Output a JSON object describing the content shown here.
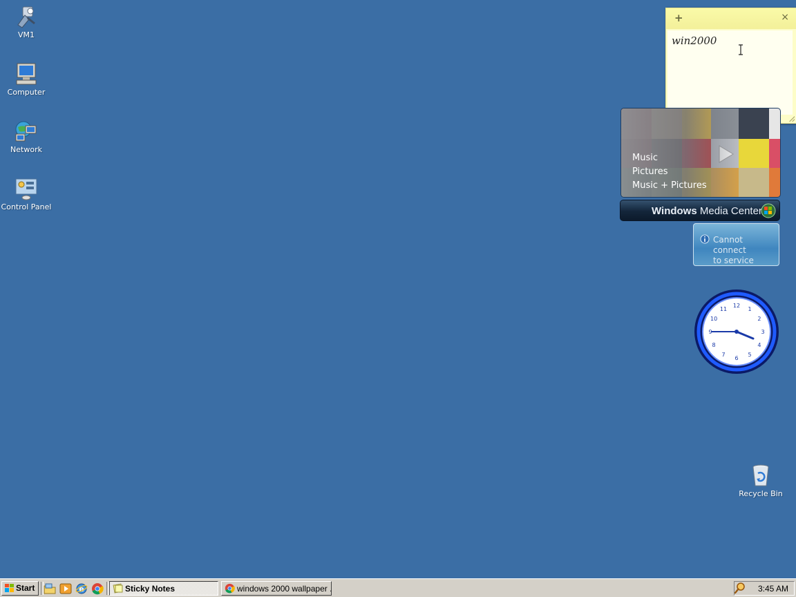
{
  "desktop": {
    "background_color": "#3b6ea5",
    "icons": [
      {
        "label": "VM1",
        "icon": "vm-icon"
      },
      {
        "label": "Computer",
        "icon": "computer-icon"
      },
      {
        "label": "Network",
        "icon": "network-icon"
      },
      {
        "label": "Control Panel",
        "icon": "control-panel-icon"
      },
      {
        "label": "Recycle Bin",
        "icon": "recycle-bin-icon"
      }
    ]
  },
  "sticky_note": {
    "add_glyph": "+",
    "close_glyph": "×",
    "text": "win2000",
    "color": "#fdfdc8"
  },
  "media_center": {
    "menu": [
      "Music",
      "Pictures",
      "Music + Pictures"
    ],
    "title_bold": "Windows",
    "title_rest": " Media Center"
  },
  "service_gadget": {
    "message_line1": "Cannot connect",
    "message_line2": "to service"
  },
  "clock": {
    "numbers": [
      "12",
      "1",
      "2",
      "3",
      "4",
      "5",
      "6",
      "7",
      "8",
      "9",
      "10",
      "11"
    ],
    "hour": 3,
    "minute": 45,
    "accent": "#1c5cff"
  },
  "taskbar": {
    "start_label": "Start",
    "quick_launch": [
      "explorer-icon",
      "media-player-icon",
      "ie-icon",
      "chrome-icon"
    ],
    "tasks": [
      {
        "label": "Sticky Notes",
        "active": true,
        "icon": "sticky-notes-icon"
      },
      {
        "label": "windows 2000 wallpaper ...",
        "active": false,
        "icon": "chrome-icon"
      }
    ],
    "clock": "3:45 AM",
    "tray_icon": "search-icon"
  }
}
